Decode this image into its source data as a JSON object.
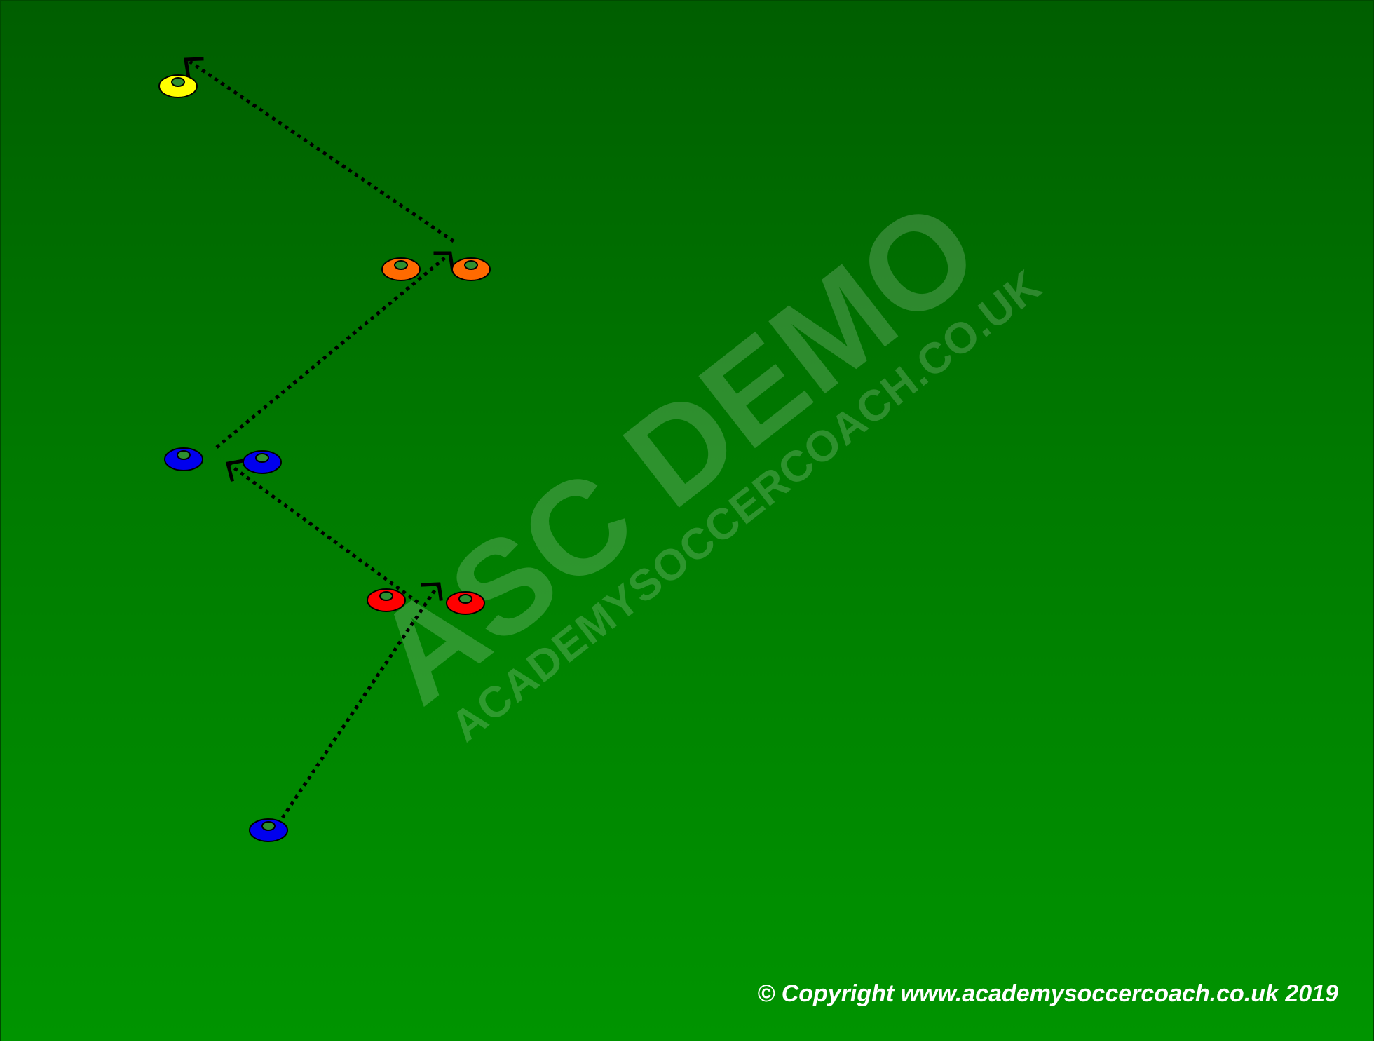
{
  "watermark": {
    "title": "ASC DEMO",
    "subtitle": "ACADEMYSOCCERCOACH.CO.UK"
  },
  "copyright": "© Copyright www.academysoccercoach.co.uk 2019",
  "colors": {
    "pitch_top": "#005e00",
    "pitch_bottom": "#009400",
    "cone_yellow": "#ffff00",
    "cone_orange": "#ff6a00",
    "cone_blue": "#0000ee",
    "cone_red": "#ff0000",
    "pass_line": "#000000"
  },
  "cones": [
    {
      "name": "cone-yellow",
      "color": "yellow"
    },
    {
      "name": "cone-orange-left",
      "color": "orange"
    },
    {
      "name": "cone-orange-right",
      "color": "orange"
    },
    {
      "name": "cone-blue-left",
      "color": "blue"
    },
    {
      "name": "cone-blue-right",
      "color": "blue"
    },
    {
      "name": "cone-red-left",
      "color": "red"
    },
    {
      "name": "cone-red-right",
      "color": "red"
    },
    {
      "name": "cone-blue-start",
      "color": "blue"
    }
  ],
  "passes": [
    {
      "name": "pass-start-to-red"
    },
    {
      "name": "pass-red-to-blue"
    },
    {
      "name": "pass-blue-to-orange"
    },
    {
      "name": "pass-orange-to-yellow"
    }
  ]
}
